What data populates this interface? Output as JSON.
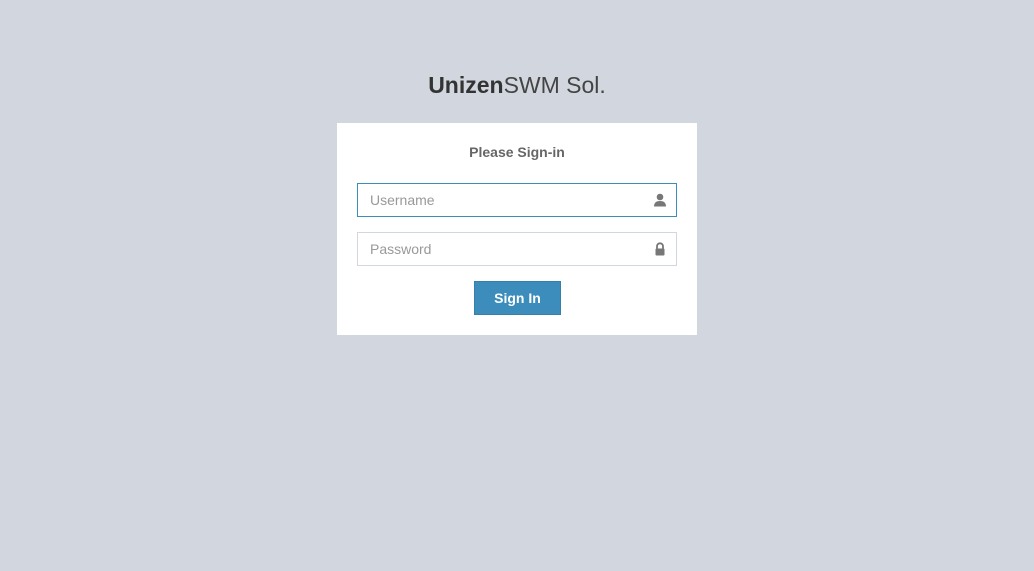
{
  "logo": {
    "bold": "Unizen",
    "light": "SWM Sol."
  },
  "login": {
    "message": "Please Sign-in",
    "username_placeholder": "Username",
    "username_value": "",
    "password_placeholder": "Password",
    "password_value": "",
    "submit_label": "Sign In"
  },
  "icons": {
    "username": "user-icon",
    "password": "lock-icon"
  },
  "colors": {
    "background": "#d2d6de",
    "box": "#ffffff",
    "primary": "#3c8dbc",
    "focus_border": "#3c8dbc",
    "icon": "#777777"
  }
}
